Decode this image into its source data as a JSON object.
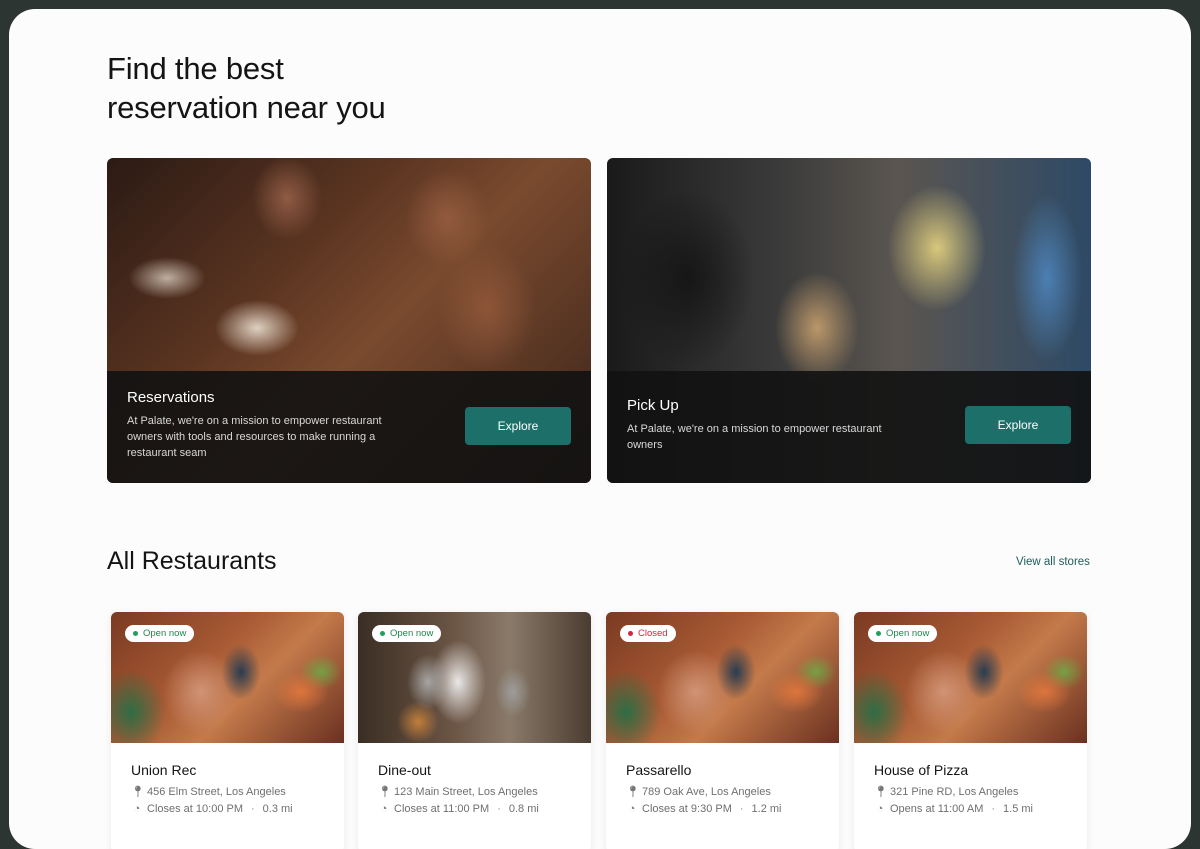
{
  "hero": {
    "title_line1": "Find the best",
    "title_line2": "reservation near you"
  },
  "promos": [
    {
      "title": "Reservations",
      "description": "At Palate, we're on a mission to empower restaurant owners with tools and resources to make running a restaurant seam",
      "button": "Explore"
    },
    {
      "title": "Pick Up",
      "description": "At Palate, we're on a mission to empower restaurant owners",
      "button": "Explore"
    }
  ],
  "restaurants_section": {
    "title": "All Restaurants",
    "view_all": "View all stores"
  },
  "restaurants": [
    {
      "status": "Open now",
      "name": "Union Rec",
      "address": "456 Elm Street, Los Angeles",
      "hours": "Closes at 10:00 PM",
      "distance": "0.3 mi"
    },
    {
      "status": "Open now",
      "name": "Dine-out",
      "address": "123 Main Street, Los Angeles",
      "hours": "Closes at 11:00 PM",
      "distance": "0.8 mi"
    },
    {
      "status": "Closed",
      "name": "Passarello",
      "address": "789 Oak Ave, Los Angeles",
      "hours": "Closes at 9:30 PM",
      "distance": "1.2 mi"
    },
    {
      "status": "Open now",
      "name": "House of Pizza",
      "address": "321 Pine RD, Los Angeles",
      "hours": "Opens at 11:00 AM",
      "distance": "1.5 mi"
    }
  ],
  "icons": {
    "location": "map-pin-icon",
    "hours": "clock-icon",
    "status": "status-dot-icon"
  },
  "colors": {
    "accent": "#1d6f6a",
    "open": "#21a05a",
    "closed": "#d0283a",
    "frame": "#2c3531"
  }
}
